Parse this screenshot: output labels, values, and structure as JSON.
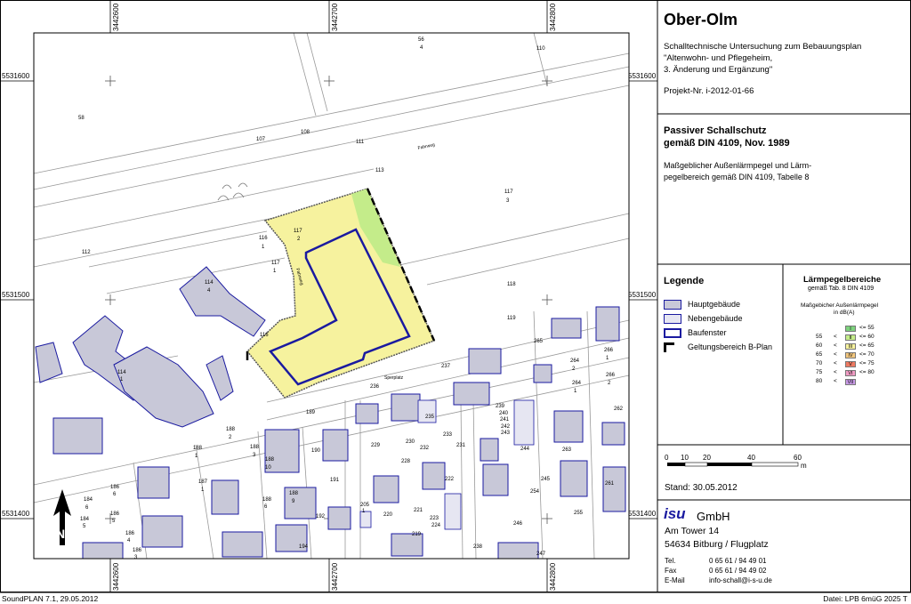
{
  "coordinates": {
    "top": [
      "3442600",
      "3442700",
      "3442800"
    ],
    "bottom": [
      "3442600",
      "3442700",
      "3442800"
    ],
    "left": [
      "5531600",
      "5531500",
      "5531400"
    ],
    "right": [
      "5531600",
      "5531500",
      "5531400"
    ]
  },
  "parcels": [
    "56",
    "4",
    "110",
    "58",
    "107",
    "108",
    "111",
    "113",
    "117",
    "3",
    "112",
    "116",
    "1",
    "117",
    "2",
    "117",
    "1",
    "114",
    "4",
    "118",
    "119",
    "265",
    "264",
    "2",
    "266",
    "1",
    "116",
    "114",
    "1",
    "237",
    "236",
    "264",
    "1",
    "266",
    "2",
    "262",
    "189",
    "239",
    "240",
    "241",
    "242",
    "243",
    "235",
    "188",
    "2",
    "188",
    "1",
    "188",
    "3",
    "188",
    "10",
    "190",
    "229",
    "230",
    "232",
    "233",
    "231",
    "228",
    "244",
    "263",
    "191",
    "187",
    "1",
    "186",
    "6",
    "186",
    "5",
    "184",
    "6",
    "184",
    "5",
    "186",
    "4",
    "186",
    "3",
    "188",
    "6",
    "188",
    "9",
    "192",
    "205",
    "1",
    "220",
    "221",
    "222",
    "223",
    "224",
    "219",
    "245",
    "254",
    "261",
    "255",
    "194",
    "246",
    "238",
    "247"
  ],
  "street_labels": [
    "Fahrweg",
    "Fahrweg",
    "Sperplatz"
  ],
  "title": "Ober-Olm",
  "description_lines": [
    "Schalltechnische Untersuchung zum Bebauungsplan",
    "\"Altenwohn- und Pflegeheim,",
    "3. Änderung und Ergänzung\""
  ],
  "project": "Projekt-Nr. i-2012-01-66",
  "section_title_lines": [
    "Passiver Schallschutz",
    "gemäß DIN 4109, Nov. 1989"
  ],
  "section_desc_lines": [
    "Maßgeblicher Außenlärmpegel und Lärm-",
    "pegelbereich gemäß DIN 4109, Tabelle 8"
  ],
  "legend": {
    "title": "Legende",
    "items": [
      {
        "label": "Hauptgebäude",
        "color": "#c8c8d8"
      },
      {
        "label": "Nebengebäude",
        "color": "#e6e6f2"
      },
      {
        "label": "Baufenster",
        "color": "#1a1aa0"
      },
      {
        "label": "Geltungsbereich B-Plan",
        "color": "#000000"
      }
    ]
  },
  "noise": {
    "title": "Lärmpegelbereiche",
    "subtitle": "gemäß Tab. 8 DIN 4109",
    "caption_lines": [
      "Maßgebicher Außenlärmpegel",
      "in dB(A)"
    ],
    "levels": [
      {
        "low": "",
        "sym": "",
        "code": "I",
        "high": "<=  55",
        "color": "#7ed27e"
      },
      {
        "low": "55",
        "sym": "<",
        "code": "II",
        "high": "<=  60",
        "color": "#c4ec8a"
      },
      {
        "low": "60",
        "sym": "<",
        "code": "III",
        "high": "<=  65",
        "color": "#f6f29e"
      },
      {
        "low": "65",
        "sym": "<",
        "code": "IV",
        "high": "<=  70",
        "color": "#f3c77e"
      },
      {
        "low": "70",
        "sym": "<",
        "code": "V",
        "high": "<=  75",
        "color": "#ee7a62"
      },
      {
        "low": "75",
        "sym": "<",
        "code": "VI",
        "high": "<=  80",
        "color": "#f09cc4"
      },
      {
        "low": "80",
        "sym": "<",
        "code": "VII",
        "high": "",
        "color": "#c89ae6"
      }
    ]
  },
  "scale": {
    "ticks": [
      "0",
      "10",
      "20",
      "40",
      "60"
    ],
    "unit": "m"
  },
  "stand": "Stand: 30.05.2012",
  "company": {
    "logo": "isu",
    "name": "GmbH",
    "address": [
      "Am Tower 14",
      "54634 Bitburg / Flugplatz"
    ],
    "contacts": [
      {
        "k": "Tel.",
        "v": "0 65 61 / 94 49 01"
      },
      {
        "k": "Fax",
        "v": "0 65 61 / 94 49 02"
      },
      {
        "k": "E-Mail",
        "v": "info-schall@i-s-u.de"
      }
    ]
  },
  "footer_left": "SoundPLAN 7.1, 29.05.2012",
  "footer_right": "Datei: LPB 6mü​G 2025 T"
}
